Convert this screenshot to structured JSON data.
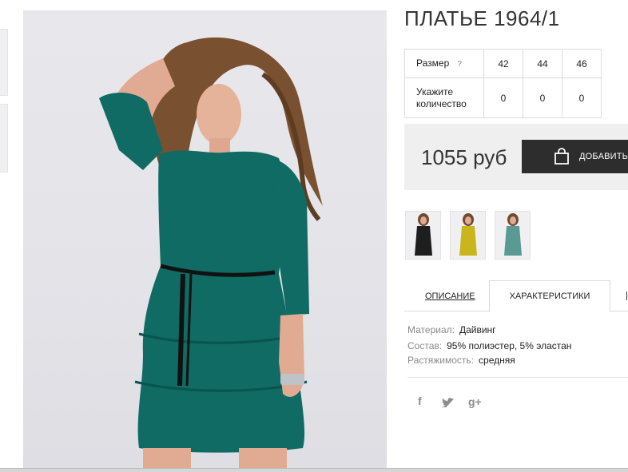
{
  "product": {
    "title": "ПЛАТЬЕ 1964/1",
    "image_icon": "main-product-photo"
  },
  "size_table": {
    "size_label": "Размер",
    "help_icon": "?",
    "sizes": [
      "42",
      "44",
      "46"
    ],
    "qty_label": "Укажите количество",
    "quantities": [
      "0",
      "0",
      "0"
    ]
  },
  "price_box": {
    "price": "1055 руб",
    "add_button_label": "ДОБАВИТЬ",
    "bag_icon": "shopping-bag-icon"
  },
  "variants": [
    {
      "name": "black",
      "color": "#1e1e1e"
    },
    {
      "name": "mustard",
      "color": "#c9b51c"
    },
    {
      "name": "teal",
      "color": "#5a9a95"
    }
  ],
  "tabs": {
    "description": "ОПИСАНИЕ",
    "characteristics": "ХАРАКТЕРИСТИКИ",
    "active": "characteristics"
  },
  "specs": [
    {
      "key": "Материал:",
      "value": "Дайвинг"
    },
    {
      "key": "Состав:",
      "value": "95% полиэстер, 5% эластан"
    },
    {
      "key": "Растяжимость:",
      "value": "средняя"
    }
  ],
  "social": {
    "facebook": "f",
    "twitter": "twitter-bird",
    "google_plus": "g+"
  },
  "colors": {
    "dress": "#0f6b63",
    "button_bg": "#2d2d2d",
    "price_bg": "#efefef"
  }
}
